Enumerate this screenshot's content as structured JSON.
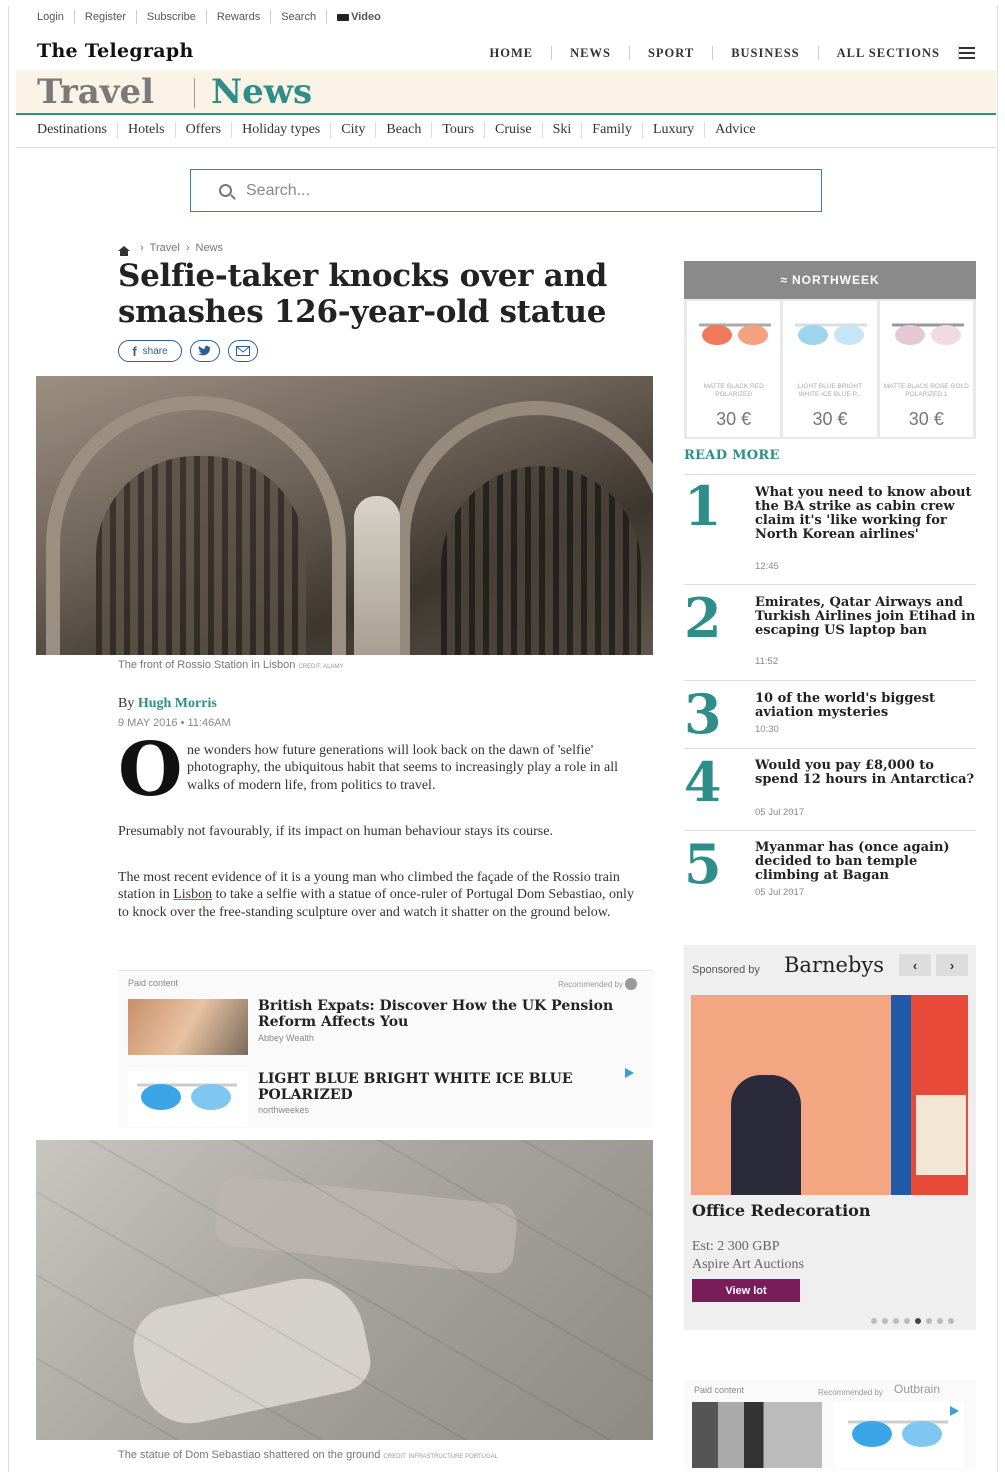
{
  "util_links": [
    "Login",
    "Register",
    "Subscribe",
    "Rewards",
    "Search"
  ],
  "video_label": "Video",
  "logo": "The Telegraph",
  "main_nav": [
    "HOME",
    "NEWS",
    "SPORT",
    "BUSINESS",
    "ALL SECTIONS"
  ],
  "section": {
    "travel": "Travel",
    "news": "News"
  },
  "sub_nav": [
    "Destinations",
    "Hotels",
    "Offers",
    "Holiday types",
    "City",
    "Beach",
    "Tours",
    "Cruise",
    "Ski",
    "Family",
    "Luxury",
    "Advice"
  ],
  "search": {
    "placeholder": "Search..."
  },
  "breadcrumb": [
    "Travel",
    "News"
  ],
  "article": {
    "headline": "Selfie-taker knocks over and smashes 126-year-old statue",
    "share_label": "share",
    "hero_caption": "The front of Rossio Station in Lisbon",
    "hero_credit": "CREDIT: ALAMY",
    "by": "By",
    "author": "Hugh Morris",
    "date": "9 MAY 2016 • 11:46AM",
    "dropcap": "O",
    "p1": "ne wonders how future generations will look back on the dawn of 'selfie' photography, the ubiquitous habit that seems to increasingly play a role in all walks of modern life, from politics to travel.",
    "p2": "Presumably not favourably, if its impact on human behaviour stays its course.",
    "p3_pre": "The most recent evidence of it is a young man who climbed the façade of the Rossio train station in ",
    "p3_link": "Lisbon",
    "p3_post": " to take a selfie with a statue of once-ruler of Portugal Dom Sebastiao, only to knock over the free-standing sculpture over and watch it shatter on the ground below.",
    "photo2_caption": "The statue of Dom Sebastiao shattered on the ground",
    "photo2_credit": "CREDIT: INFRASTRUCTURE PORTUGAL"
  },
  "paid_content": {
    "label": "Paid content",
    "recommended": "Recommended by",
    "items": [
      {
        "title": "British Expats: Discover How the UK Pension Reform Affects You",
        "source": "Abbey Wealth"
      },
      {
        "title": "LIGHT BLUE BRIGHT WHITE ICE BLUE POLARIZED",
        "source": "northweekes"
      }
    ]
  },
  "northweek_ad": {
    "brand": "NORTHWEEK",
    "items": [
      {
        "name": "MATTE BLACK RED POLARIZED",
        "price": "30 €",
        "lens": "#f07a5a"
      },
      {
        "name": "LIGHT BLUE BRIGHT WHITE ICE BLUE P...",
        "price": "30 €",
        "lens": "#9fd4ee"
      },
      {
        "name": "MATTE BLACK ROSE GOLD POLARIZED 1",
        "price": "30 €",
        "lens": "#e6c9d4"
      }
    ]
  },
  "read_more": {
    "heading": "READ MORE",
    "items": [
      {
        "num": "1",
        "title": "What you need to know about the BA strike as cabin crew claim it's 'like working for North Korean airlines'",
        "time": "12:45"
      },
      {
        "num": "2",
        "title": "Emirates, Qatar Airways and Turkish Airlines join Etihad in escaping US laptop ban",
        "time": "11:52"
      },
      {
        "num": "3",
        "title": "10 of the world's biggest aviation mysteries",
        "time": "10:30"
      },
      {
        "num": "4",
        "title": "Would you pay £8,000 to spend 12 hours in Antarctica?",
        "time": "05 Jul 2017"
      },
      {
        "num": "5",
        "title": "Myanmar has (once again) decided to ban temple climbing at Bagan",
        "time": "05 Jul 2017"
      }
    ]
  },
  "sponsored": {
    "by": "Sponsored by",
    "brand": "Barnebys",
    "title": "Office Redecoration",
    "est": "Est: 2 300 GBP",
    "house": "Aspire Art Auctions",
    "button": "View lot",
    "prev": "‹",
    "next": "›"
  },
  "paid_content_2": {
    "label": "Paid content",
    "recommended": "Recommended by",
    "brand": "Outbrain"
  },
  "colors": {
    "accent": "#2f8d8a",
    "section_bg": "#fbf4e6",
    "viewlot": "#7a1b5a"
  }
}
